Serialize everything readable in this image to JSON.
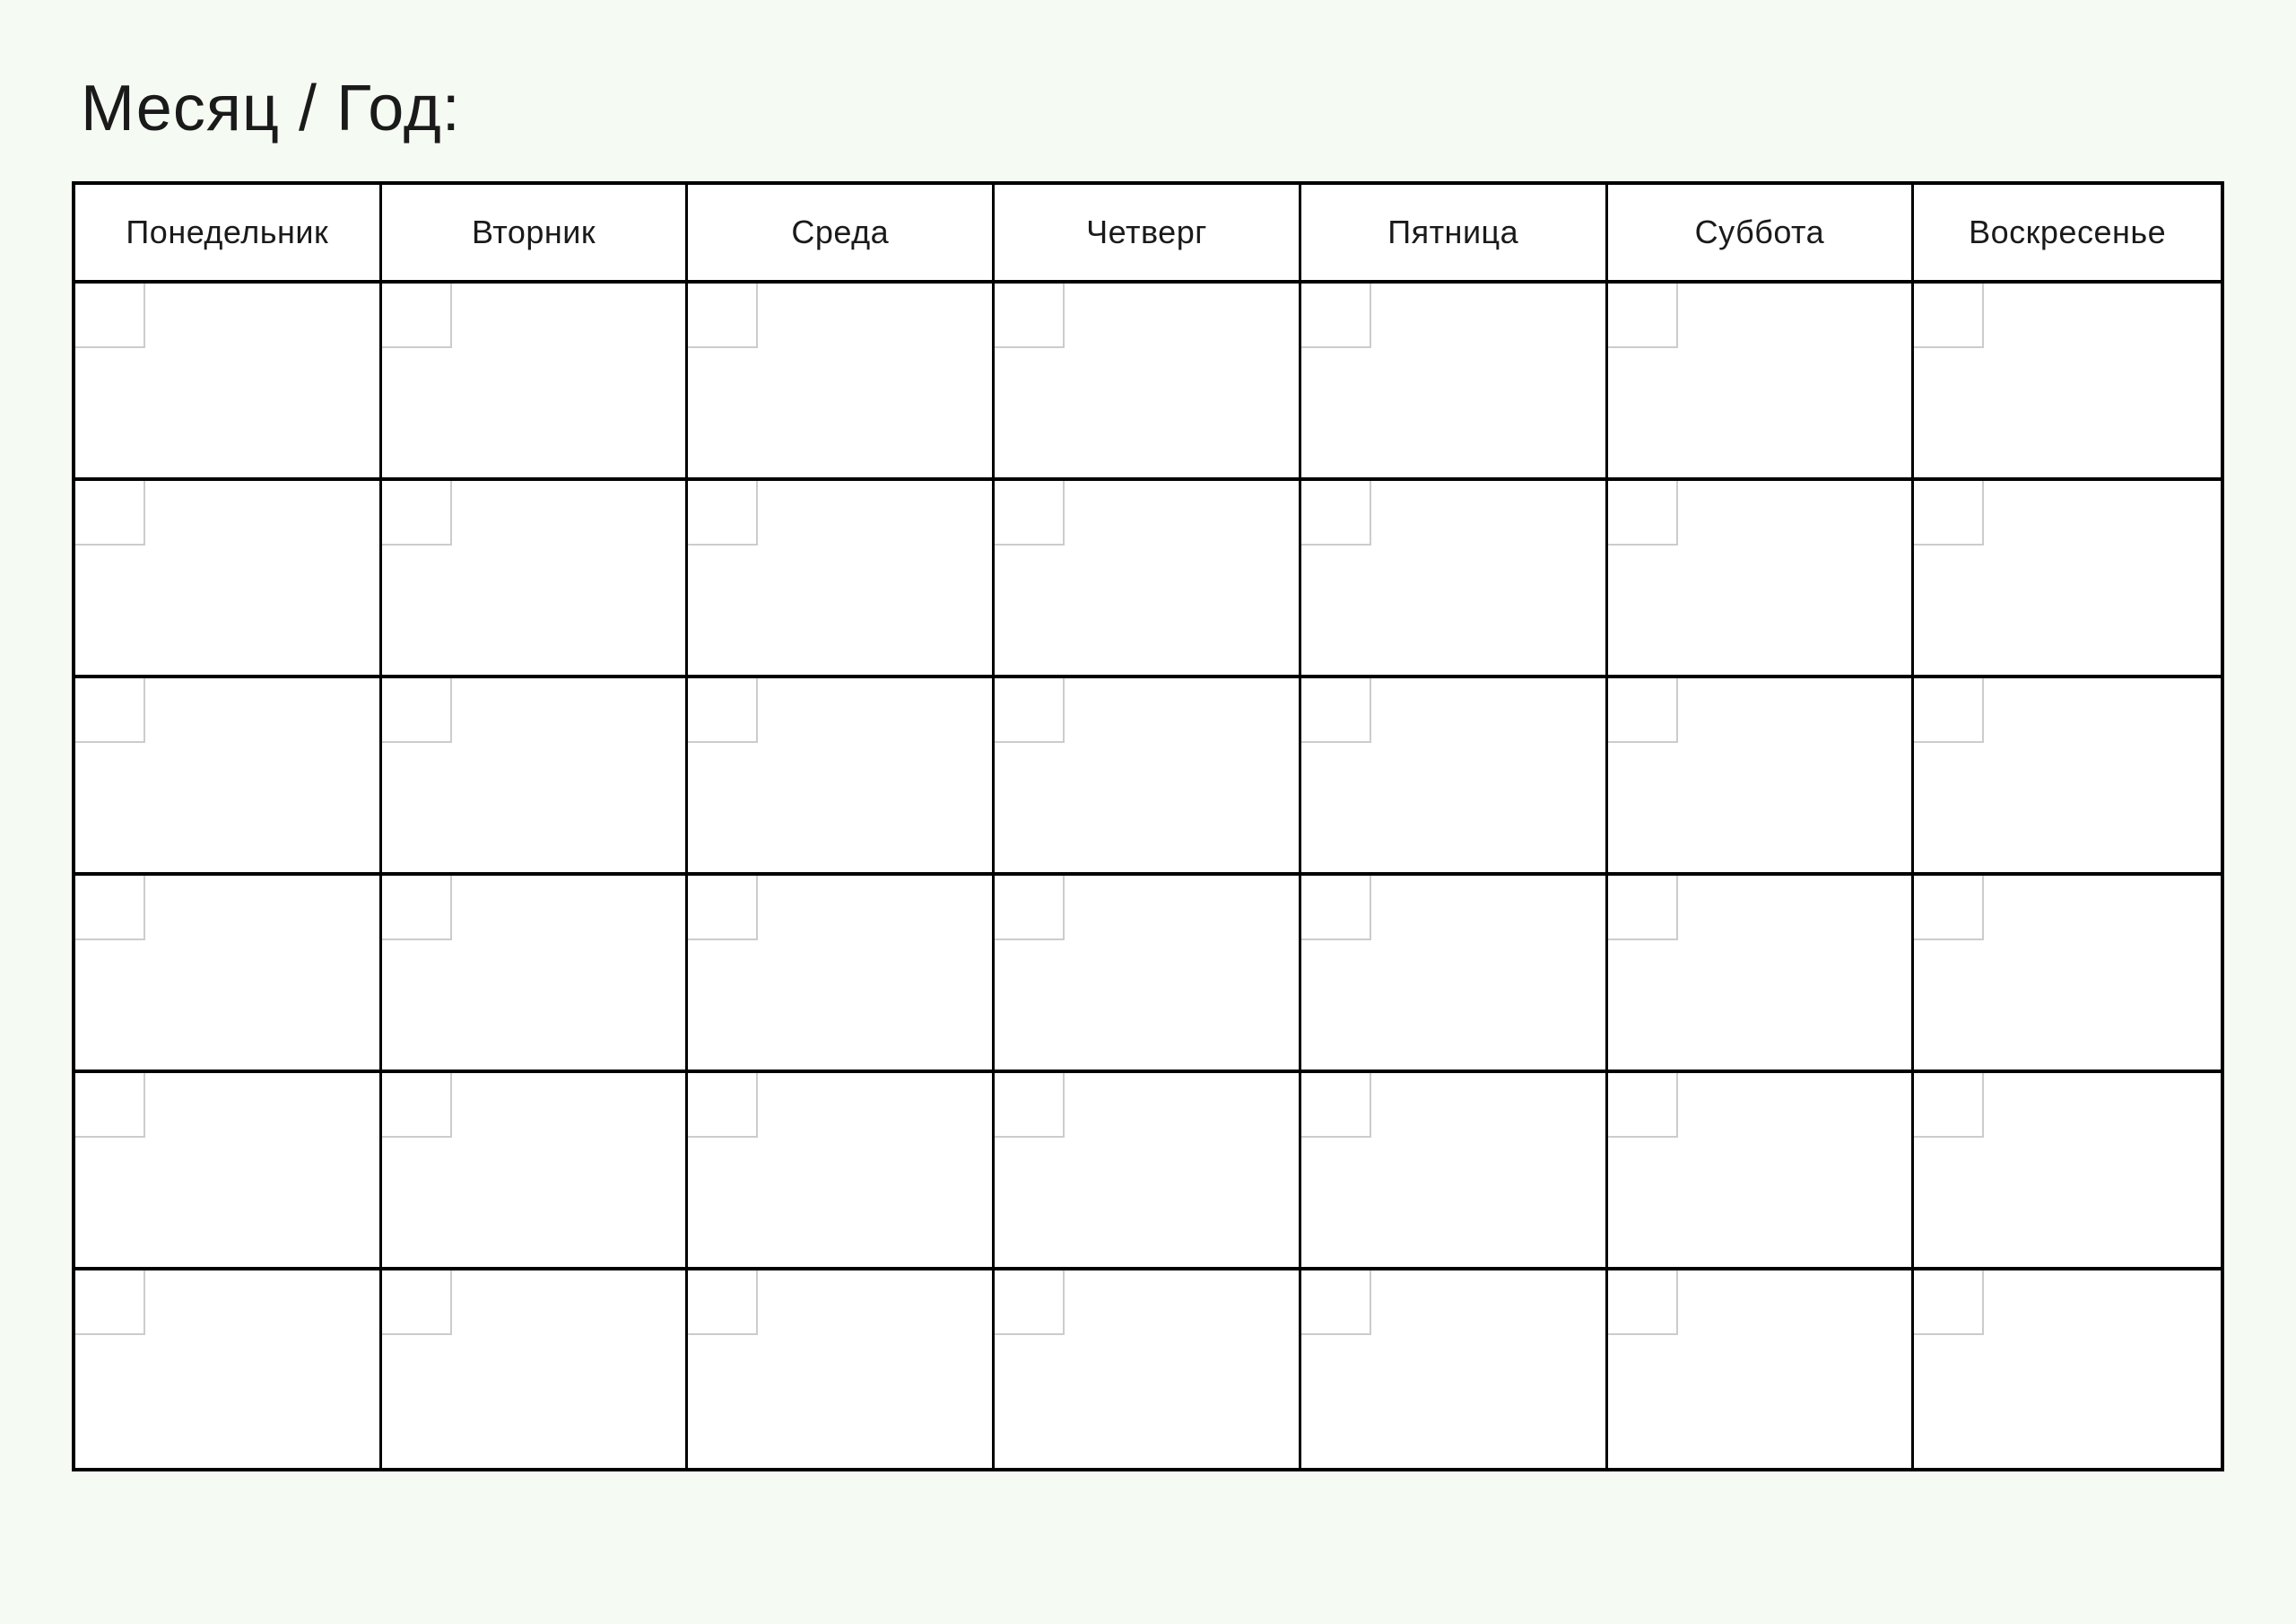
{
  "title": "Месяц / Год:",
  "days": {
    "0": "Понедельник",
    "1": "Вторник",
    "2": "Среда",
    "3": "Четверг",
    "4": "Пятница",
    "5": "Суббота",
    "6": "Воскресенье"
  },
  "weeks_count": 6
}
